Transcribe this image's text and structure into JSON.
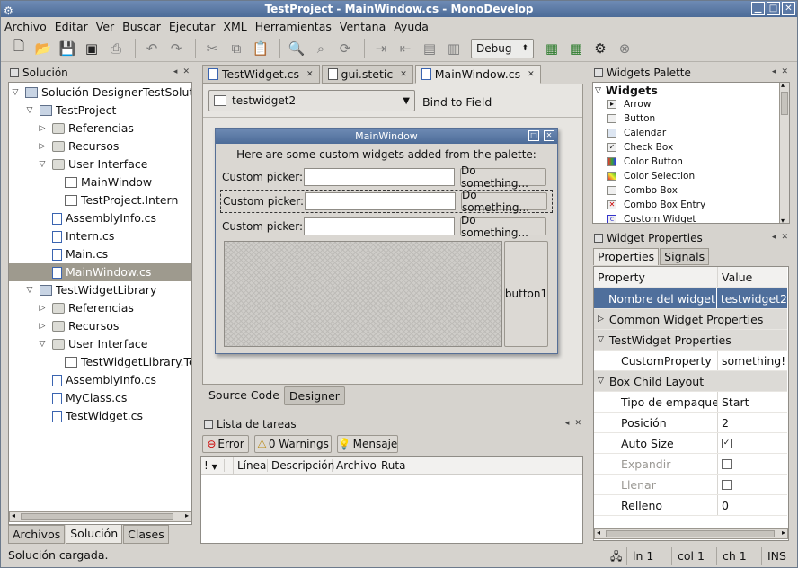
{
  "window": {
    "title": "TestProject - MainWindow.cs - MonoDevelop"
  },
  "menu": [
    "Archivo",
    "Editar",
    "Ver",
    "Buscar",
    "Ejecutar",
    "XML",
    "Herramientas",
    "Ventana",
    "Ayuda"
  ],
  "toolbar": {
    "config": "Debug"
  },
  "solution": {
    "title": "Solución",
    "items": [
      {
        "label": "Solución DesignerTestSolution"
      },
      {
        "label": "TestProject"
      },
      {
        "label": "Referencias"
      },
      {
        "label": "Recursos"
      },
      {
        "label": "User Interface"
      },
      {
        "label": "MainWindow"
      },
      {
        "label": "TestProject.Intern"
      },
      {
        "label": "AssemblyInfo.cs"
      },
      {
        "label": "Intern.cs"
      },
      {
        "label": "Main.cs"
      },
      {
        "label": "MainWindow.cs"
      },
      {
        "label": "TestWidgetLibrary"
      },
      {
        "label": "Referencias"
      },
      {
        "label": "Recursos"
      },
      {
        "label": "User Interface"
      },
      {
        "label": "TestWidgetLibrary.Tes"
      },
      {
        "label": "AssemblyInfo.cs"
      },
      {
        "label": "MyClass.cs"
      },
      {
        "label": "TestWidget.cs"
      }
    ],
    "tabs": [
      "Archivos",
      "Solución",
      "Clases"
    ]
  },
  "editor": {
    "tabs": [
      "TestWidget.cs",
      "gui.stetic",
      "MainWindow.cs"
    ],
    "widget_combo": "testwidget2",
    "bind": "Bind to Field",
    "designer": {
      "window_title": "MainWindow",
      "intro": "Here are some custom widgets added from the palette:",
      "picker_label": "Custom picker:",
      "do_button": "Do something...",
      "button1": "button1"
    },
    "bottom_tabs": [
      "Source Code",
      "Designer"
    ]
  },
  "tasks": {
    "title": "Lista de tareas",
    "filters": [
      "Error",
      "0 Warnings",
      "Mensaje"
    ],
    "columns": [
      "!",
      "Línea",
      "Descripción",
      "Archivo",
      "Ruta"
    ]
  },
  "palette": {
    "title": "Widgets Palette",
    "group": "Widgets",
    "items": [
      "Arrow",
      "Button",
      "Calendar",
      "Check Box",
      "Color Button",
      "Color Selection",
      "Combo Box",
      "Combo Box Entry",
      "Custom Widget"
    ]
  },
  "props": {
    "title": "Widget Properties",
    "tabs": [
      "Properties",
      "Signals"
    ],
    "col_property": "Property",
    "col_value": "Value",
    "rows": [
      {
        "k": "Nombre del widget",
        "v": "testwidget2"
      },
      {
        "k": "Common Widget Properties",
        "v": ""
      },
      {
        "k": "TestWidget Properties",
        "v": ""
      },
      {
        "k": "CustomProperty",
        "v": "something!"
      },
      {
        "k": "Box Child Layout",
        "v": ""
      },
      {
        "k": "Tipo de empaqueta",
        "v": "Start"
      },
      {
        "k": "Posición",
        "v": "2"
      },
      {
        "k": "Auto Size",
        "v": ""
      },
      {
        "k": "Expandir",
        "v": ""
      },
      {
        "k": "Llenar",
        "v": ""
      },
      {
        "k": "Relleno",
        "v": "0"
      }
    ]
  },
  "status": {
    "msg": "Solución cargada.",
    "ln": "ln 1",
    "col": "col 1",
    "ch": "ch 1",
    "ins": "INS"
  }
}
